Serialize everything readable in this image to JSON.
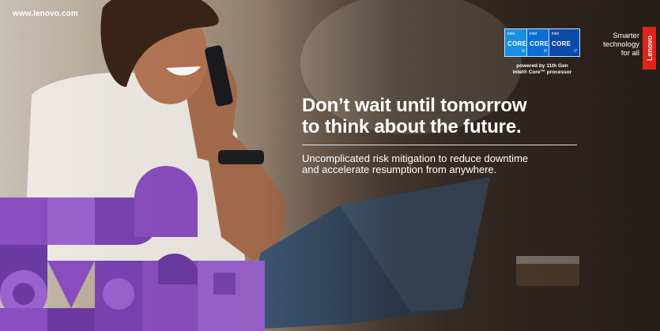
{
  "banner": {
    "url": "www.lenovo.com",
    "headline_line1": "Don’t wait until tomorrow",
    "headline_line2": "to think about the future.",
    "subhead_line1": "Uncomplicated risk mitigation to reduce downtime",
    "subhead_line2": "and accelerate resumption from anywhere.",
    "tagline_line1": "Smarter",
    "tagline_line2": "technology",
    "tagline_line3": "for all",
    "logo_text": "Lenovo",
    "powered_line1": "powered by 11th Gen",
    "powered_line2": "Intel® Core™ processor"
  },
  "badges": [
    {
      "brand": "intel",
      "core": "CORE",
      "tier": "i3"
    },
    {
      "brand": "intel",
      "core": "CORE",
      "tier": "i5"
    },
    {
      "brand": "intel",
      "core": "CORE",
      "tier": "i7"
    }
  ],
  "colors": {
    "accent_purple": "#8a4fc0",
    "dark_purple": "#6c3aa3",
    "lenovo_red": "#e2231a",
    "intel_blue": "#0a6fd6"
  }
}
